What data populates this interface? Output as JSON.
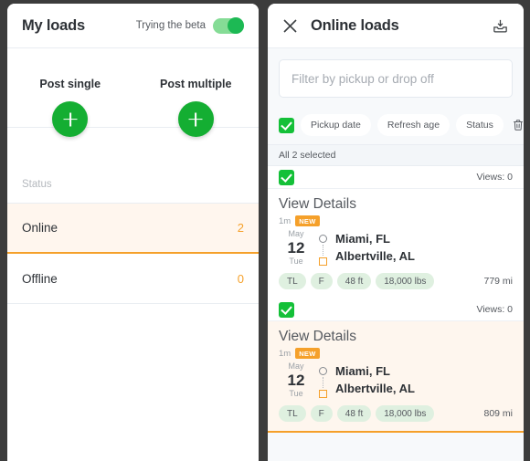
{
  "theme": {
    "green": "#14ae32",
    "orange": "#f5a02a",
    "selected_bg": "#fef6ee",
    "panel_bg": "#f7f9fb"
  },
  "left_panel": {
    "title": "My loads",
    "beta": {
      "label": "Trying the beta",
      "enabled": true
    },
    "post_actions": [
      {
        "label": "Post single",
        "icon": "plus-icon"
      },
      {
        "label": "Post multiple",
        "icon": "plus-icon"
      }
    ],
    "status_caption": "Status",
    "status_rows": [
      {
        "name": "Online",
        "count": "2",
        "active": true
      },
      {
        "name": "Offline",
        "count": "0",
        "active": false
      }
    ]
  },
  "right_panel": {
    "title": "Online loads",
    "close_icon": "close-icon",
    "tray_icon": "inbox-download-icon",
    "filter": {
      "placeholder": "Filter by pickup or drop off",
      "value": ""
    },
    "select_all_checked": true,
    "chips": [
      {
        "label": "Pickup date"
      },
      {
        "label": "Refresh age"
      },
      {
        "label": "Status"
      }
    ],
    "trash_icon": "trash-icon",
    "selected_bar": "All 2 selected",
    "cards": [
      {
        "checked": true,
        "views": "Views: 0",
        "details_link": "View Details",
        "age": "1m",
        "badge": "NEW",
        "date": {
          "month": "May",
          "day": "12",
          "weekday": "Tue"
        },
        "origin": "Miami, FL",
        "destination": "Albertville, AL",
        "tags": [
          "TL",
          "F",
          "48 ft",
          "18,000 lbs"
        ],
        "miles": "779 mi",
        "selected": false
      },
      {
        "checked": true,
        "views": "Views: 0",
        "details_link": "View Details",
        "age": "1m",
        "badge": "NEW",
        "date": {
          "month": "May",
          "day": "12",
          "weekday": "Tue"
        },
        "origin": "Miami, FL",
        "destination": "Albertville, AL",
        "tags": [
          "TL",
          "F",
          "48 ft",
          "18,000 lbs"
        ],
        "miles": "809 mi",
        "selected": true
      }
    ]
  }
}
